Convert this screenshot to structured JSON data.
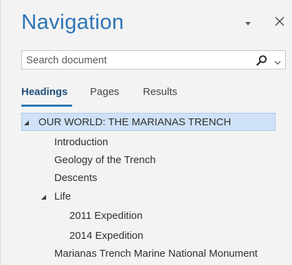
{
  "pane": {
    "title": "Navigation"
  },
  "search": {
    "placeholder": "Search document",
    "value": ""
  },
  "tabs": [
    {
      "label": "Headings",
      "active": true
    },
    {
      "label": "Pages",
      "active": false
    },
    {
      "label": "Results",
      "active": false
    }
  ],
  "tree": [
    {
      "label": "OUR WORLD:  THE MARIANAS TRENCH",
      "level": 0,
      "expandable": true,
      "expanded": true,
      "selected": true
    },
    {
      "label": "Introduction",
      "level": 1,
      "expandable": false,
      "selected": false
    },
    {
      "label": "Geology of the Trench",
      "level": 1,
      "expandable": false,
      "selected": false
    },
    {
      "label": "Descents",
      "level": 1,
      "expandable": false,
      "selected": false
    },
    {
      "label": "Life",
      "level": 1,
      "expandable": true,
      "expanded": true,
      "selected": false
    },
    {
      "label": "2011 Expedition",
      "level": 2,
      "expandable": false,
      "selected": false
    },
    {
      "label": "2014 Expedition",
      "level": 2,
      "expandable": false,
      "selected": false
    },
    {
      "label": "Marianas Trench Marine National Monument",
      "level": 1,
      "expandable": false,
      "selected": false
    }
  ],
  "colors": {
    "accent": "#2e75b6",
    "selection": "#cfe2f7",
    "pane_bg": "#f3f3f3"
  },
  "icons": {
    "dropdown": "triangle-down-icon",
    "close": "close-icon",
    "search": "magnifier-icon",
    "search_options": "chevron-down-icon",
    "expanded": "expanded-triangle-icon"
  }
}
